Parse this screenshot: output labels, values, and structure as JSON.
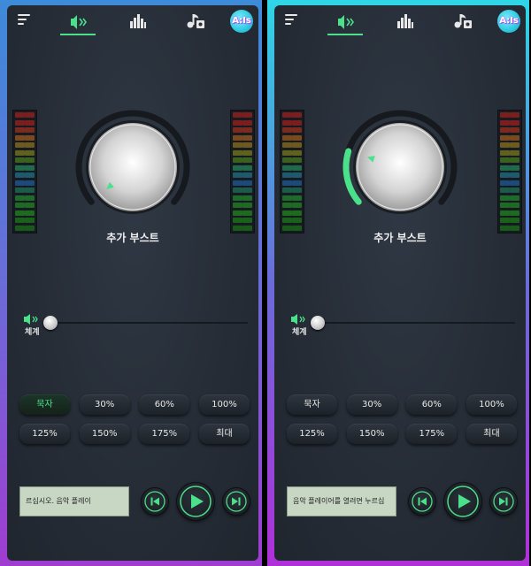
{
  "colors": {
    "accent": "#4be08a",
    "panel": "#262d37",
    "lcd": "#c8d6c4"
  },
  "header": {
    "menu_icon": "hamburger-menu-icon",
    "tabs": [
      {
        "name": "volume",
        "icon": "speaker-volume-icon",
        "active": true
      },
      {
        "name": "equalizer",
        "icon": "equalizer-bars-icon",
        "active": false
      },
      {
        "name": "music",
        "icon": "music-note-icon",
        "active": false
      }
    ],
    "avatar_text": "A:Is"
  },
  "screens": [
    {
      "boost_label": "추가 부스트",
      "boost_level": 0,
      "volume_label": "체계",
      "volume_level": 0,
      "presets": [
        "묵자",
        "30%",
        "60%",
        "100%",
        "125%",
        "150%",
        "175%",
        "최대"
      ],
      "active_preset": 0,
      "lcd_text": "르십시오.          음악 플레이",
      "player_icons": [
        "skip-previous-icon",
        "play-icon",
        "skip-next-icon"
      ]
    },
    {
      "boost_label": "추가 부스트",
      "boost_level": 0.22,
      "volume_label": "체계",
      "volume_level": 0,
      "presets": [
        "묵자",
        "30%",
        "60%",
        "100%",
        "125%",
        "150%",
        "175%",
        "최대"
      ],
      "active_preset": -1,
      "lcd_text": "음악 플레이어를 열려면 누르십",
      "player_icons": [
        "skip-previous-icon",
        "play-icon",
        "skip-next-icon"
      ]
    }
  ]
}
